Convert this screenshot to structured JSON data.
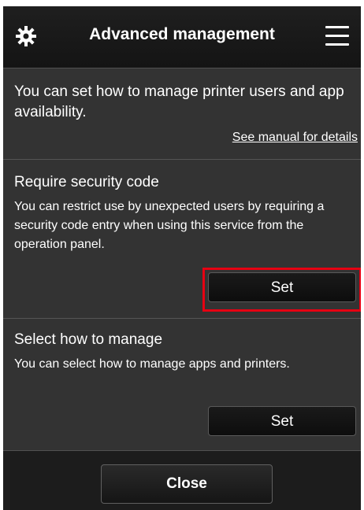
{
  "header": {
    "title": "Advanced management",
    "left_icon": "gear-icon",
    "right_icon": "menu-icon"
  },
  "intro": {
    "text": "You can set how to manage printer users and app availability.",
    "manual_link": "See manual for details"
  },
  "security_code": {
    "heading": "Require security code",
    "description": "You can restrict use by unexpected users by requiring a security code entry when using this service from the operation panel.",
    "button_label": "Set",
    "highlighted": true
  },
  "manage": {
    "heading": "Select how to manage",
    "description": "You can select how to manage apps and printers.",
    "button_label": "Set"
  },
  "footer": {
    "close_label": "Close"
  },
  "colors": {
    "highlight": "#e60012",
    "background": "#333333",
    "header": "#1a1a1a"
  }
}
